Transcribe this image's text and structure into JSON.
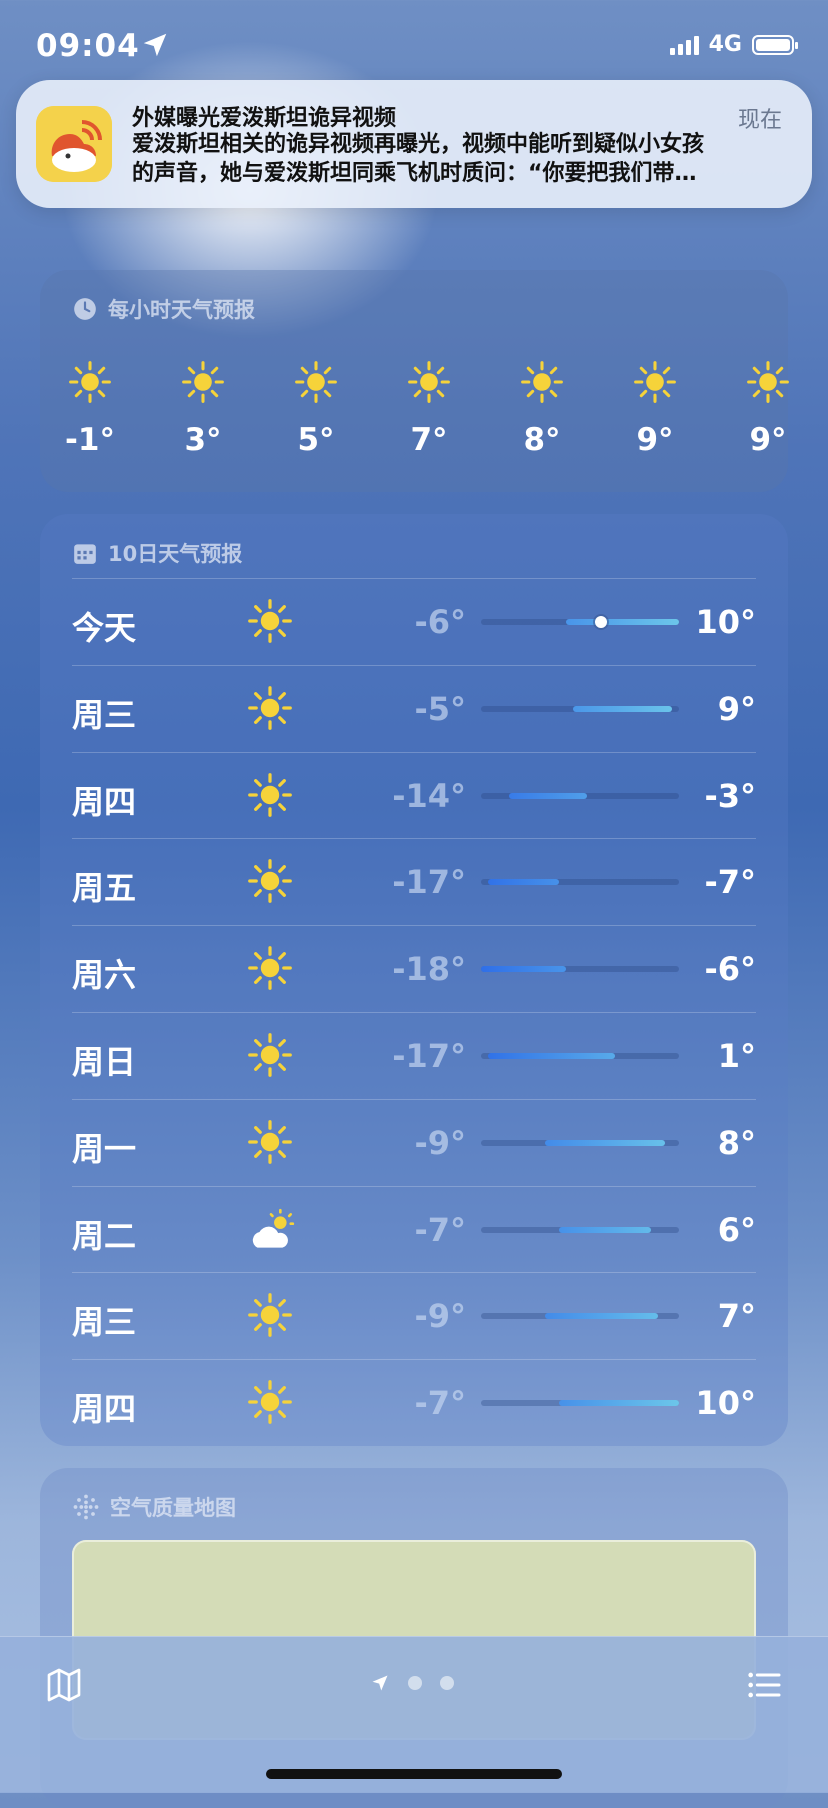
{
  "status_bar": {
    "time": "09:04",
    "network": "4G"
  },
  "notification": {
    "title": "外媒曝光爱泼斯坦诡异视频",
    "time": "现在",
    "body_line1": "爱泼斯坦相关的诡异视频再曝光，视频中能听到疑似小女孩",
    "body_line2": "的声音，她与爱泼斯坦同乘飞机时质问：“你要把我们带…"
  },
  "hourly": {
    "title": "每小时天气预报",
    "items": [
      {
        "temp": "-1°",
        "icon": "sun-icon"
      },
      {
        "temp": "3°",
        "icon": "sun-icon"
      },
      {
        "temp": "5°",
        "icon": "sun-icon"
      },
      {
        "temp": "7°",
        "icon": "sun-icon"
      },
      {
        "temp": "8°",
        "icon": "sun-icon"
      },
      {
        "temp": "9°",
        "icon": "sun-icon"
      },
      {
        "temp": "9°",
        "icon": "sun-icon"
      }
    ]
  },
  "daily": {
    "title": "10日天气预报",
    "range_min": -18,
    "range_max": 10,
    "days": [
      {
        "day": "今天",
        "icon": "sun-icon",
        "lo": "-6°",
        "hi": "10°",
        "lo_v": -6,
        "hi_v": 10,
        "current": -1
      },
      {
        "day": "周三",
        "icon": "sun-icon",
        "lo": "-5°",
        "hi": "9°",
        "lo_v": -5,
        "hi_v": 9
      },
      {
        "day": "周四",
        "icon": "sun-icon",
        "lo": "-14°",
        "hi": "-3°",
        "lo_v": -14,
        "hi_v": -3
      },
      {
        "day": "周五",
        "icon": "sun-icon",
        "lo": "-17°",
        "hi": "-7°",
        "lo_v": -17,
        "hi_v": -7
      },
      {
        "day": "周六",
        "icon": "sun-icon",
        "lo": "-18°",
        "hi": "-6°",
        "lo_v": -18,
        "hi_v": -6
      },
      {
        "day": "周日",
        "icon": "sun-icon",
        "lo": "-17°",
        "hi": "1°",
        "lo_v": -17,
        "hi_v": 1
      },
      {
        "day": "周一",
        "icon": "sun-icon",
        "lo": "-9°",
        "hi": "8°",
        "lo_v": -9,
        "hi_v": 8
      },
      {
        "day": "周二",
        "icon": "partly-cloudy-icon",
        "lo": "-7°",
        "hi": "6°",
        "lo_v": -7,
        "hi_v": 6
      },
      {
        "day": "周三",
        "icon": "sun-icon",
        "lo": "-9°",
        "hi": "7°",
        "lo_v": -9,
        "hi_v": 7
      },
      {
        "day": "周四",
        "icon": "sun-icon",
        "lo": "-7°",
        "hi": "10°",
        "lo_v": -7,
        "hi_v": 10
      }
    ]
  },
  "air_quality": {
    "title": "空气质量地图"
  },
  "colors": {
    "sun": "#f6d33a",
    "cold": "#2f6fe8",
    "cool": "#6cc6ea"
  }
}
